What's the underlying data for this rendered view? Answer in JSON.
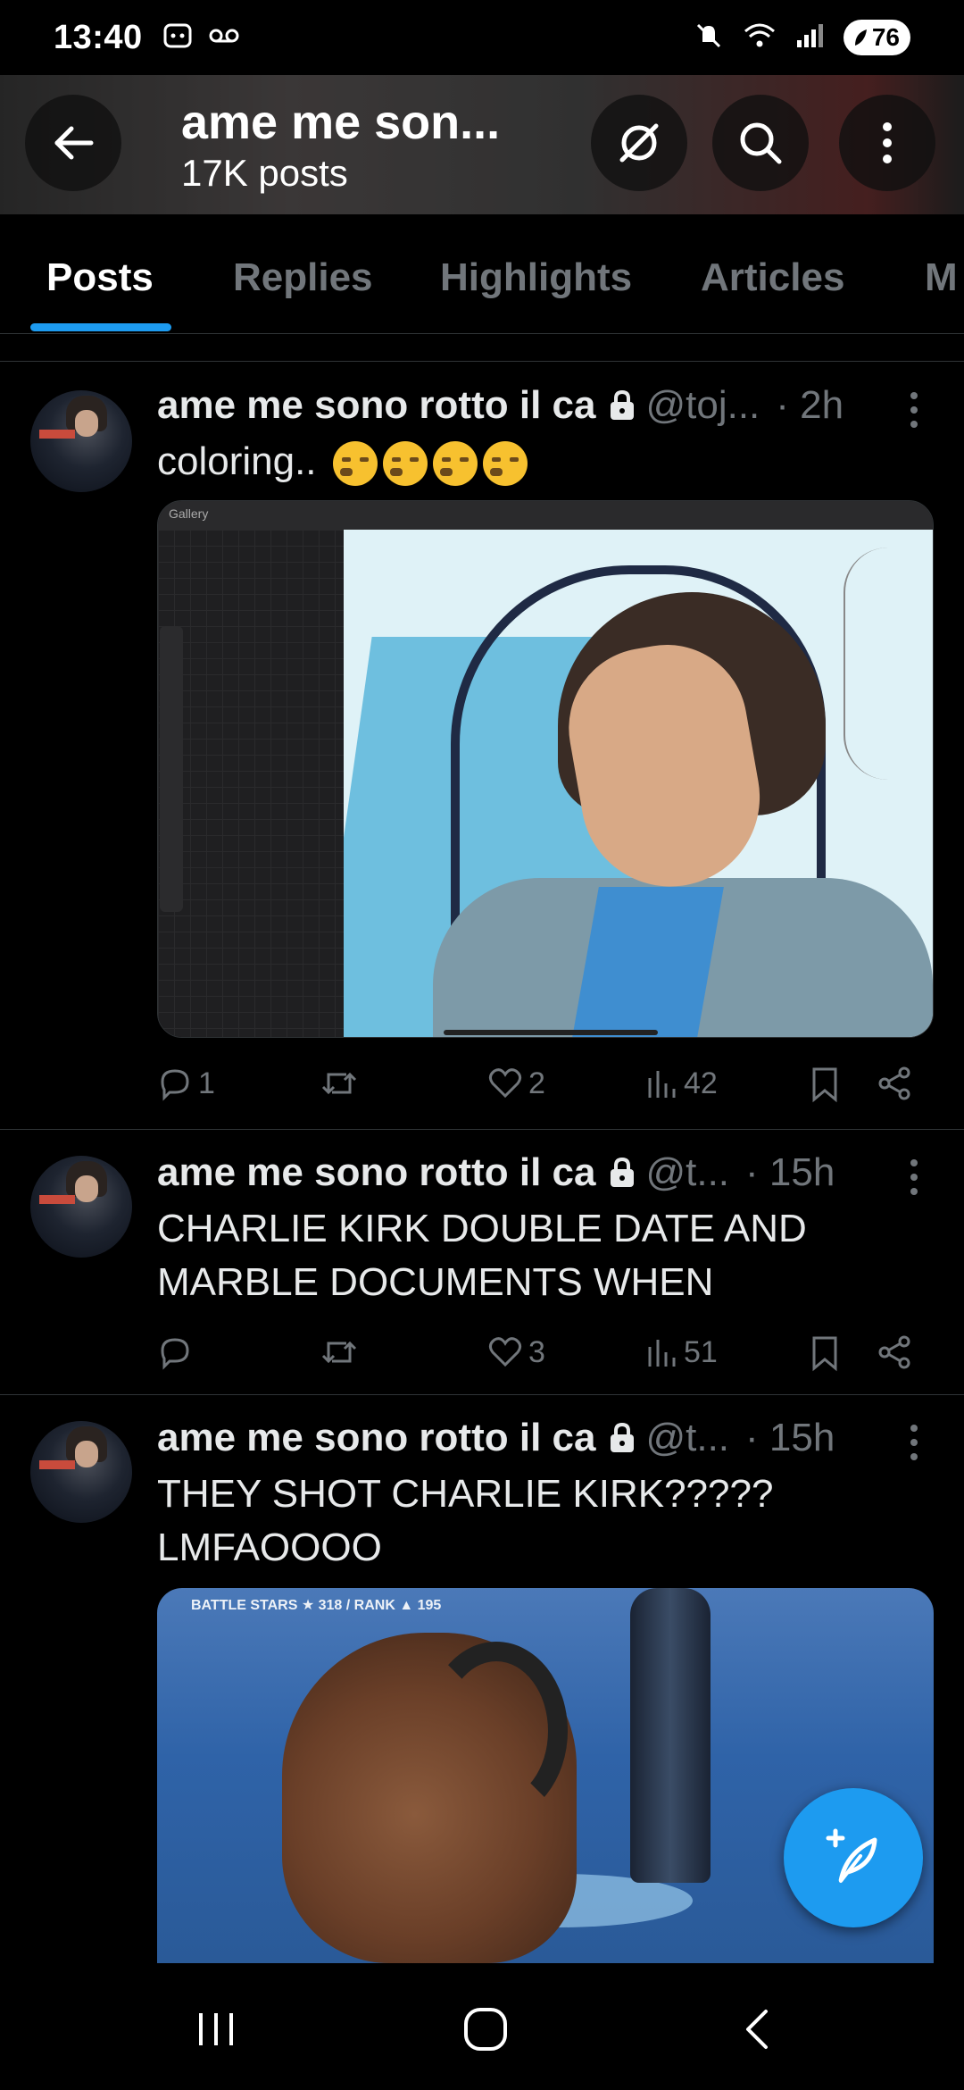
{
  "status_bar": {
    "time": "13:40",
    "battery": "76",
    "icons": [
      "screenshot-icon",
      "voicemail-icon",
      "mute-icon",
      "wifi-icon",
      "signal-icon"
    ]
  },
  "header": {
    "title": "ame me son...",
    "post_count": "17K posts",
    "buttons": [
      "back-arrow-icon",
      "grok-icon",
      "search-icon",
      "more-vertical-icon"
    ]
  },
  "tabs": [
    {
      "label": "Posts",
      "active": true
    },
    {
      "label": "Replies",
      "active": false
    },
    {
      "label": "Highlights",
      "active": false
    },
    {
      "label": "Articles",
      "active": false
    },
    {
      "label": "M",
      "active": false
    }
  ],
  "posts": [
    {
      "author": "ame me sono rotto il ca",
      "handle": "@toj...",
      "time": "· 2h",
      "text": "coloring..",
      "media": "drawing-app-screenshot",
      "media_label": "Gallery",
      "replies": "1",
      "reposts": "",
      "likes": "2",
      "views": "42"
    },
    {
      "author": "ame me sono rotto il ca",
      "handle": "@t...",
      "time": "· 15h",
      "text": "CHARLIE KIRK DOUBLE DATE AND MARBLE DOCUMENTS WHEN",
      "replies": "",
      "reposts": "",
      "likes": "3",
      "views": "51"
    },
    {
      "author": "ame me sono rotto il ca",
      "handle": "@t...",
      "time": "· 15h",
      "text": "THEY SHOT CHARLIE KIRK????? LMFAOOOO",
      "media": "video-still",
      "media_hud": "BATTLE STARS ★ 318 / RANK ▲ 195"
    }
  ],
  "colors": {
    "accent": "#1d9bf0",
    "text_primary": "#e7e9ea",
    "text_secondary": "#71767b",
    "divider": "#2f3336",
    "background": "#000000"
  }
}
